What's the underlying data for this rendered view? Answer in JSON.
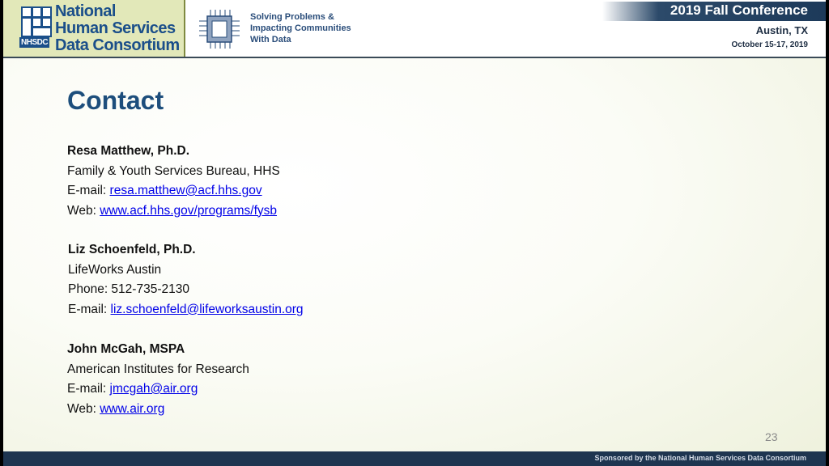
{
  "header": {
    "logo_lines": [
      "National",
      "Human Services",
      "Data Consortium"
    ],
    "logo_abbr": "NHSDC",
    "tagline_lines": [
      "Solving Problems &",
      "Impacting Communities",
      "With Data"
    ],
    "conference_title": "2019 Fall Conference",
    "conference_city": "Austin, TX",
    "conference_dates": "October 15-17, 2019"
  },
  "slide": {
    "title": "Contact",
    "page_number": "23",
    "contacts": [
      {
        "name": "Resa Matthew, Ph.D.",
        "org": "Family & Youth Services Bureau, HHS",
        "email_label": "E-mail: ",
        "email": "resa.matthew@acf.hhs.gov",
        "web_label": "Web: ",
        "web": "www.acf.hhs.gov/programs/fysb"
      },
      {
        "name": "Liz Schoenfeld, Ph.D.",
        "org": "LifeWorks Austin",
        "phone": "Phone: 512-735-2130",
        "email_label": "E-mail: ",
        "email": "liz.schoenfeld@lifeworksaustin.org"
      },
      {
        "name": "John McGah, MSPA",
        "org": "American Institutes for Research",
        "email_label": "E-mail: ",
        "email": "jmcgah@air.org",
        "web_label": "Web: ",
        "web": "www.air.org"
      }
    ]
  },
  "footer": {
    "text": "Sponsored by the National Human Services Data Consortium"
  }
}
